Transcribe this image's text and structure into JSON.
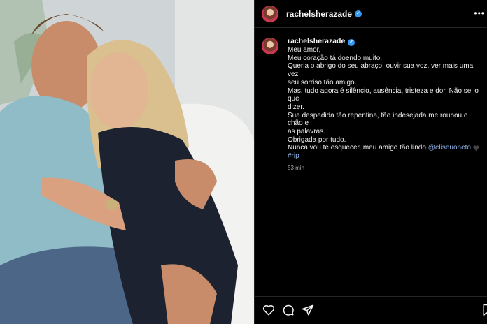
{
  "post": {
    "username": "rachelsherazade",
    "verified_glyph": "✓",
    "more_glyph": "•••",
    "caption_user": "rachelsherazade",
    "caption_user_suffix": ".",
    "caption_lines": [
      "Meu amor,",
      "Meu coração tá doendo muito.",
      "Queria o abrigo do seu abraço, ouvir sua voz, ver mais uma vez",
      "seu sorriso tão amigo.",
      "Mas, tudo agora é silêncio, ausência, tristeza e dor. Não sei o que",
      "dizer.",
      "Sua despedida tão repentina, tão indesejada me roubou o chão e",
      "as palavras.",
      "Obrigada por tudo."
    ],
    "last_line_text": "Nunca vou te esquecer, meu amigo tão lindo ",
    "mention": "@eliseuoneto",
    "hashtag": "#rip",
    "time_ago": "53 min"
  },
  "icons": {
    "like": "heart-icon",
    "comment": "comment-icon",
    "share": "share-icon",
    "save": "bookmark-icon",
    "more": "more-icon"
  },
  "colors": {
    "background": "#000000",
    "mention": "#8fb2e6",
    "verified": "#3897f0"
  }
}
